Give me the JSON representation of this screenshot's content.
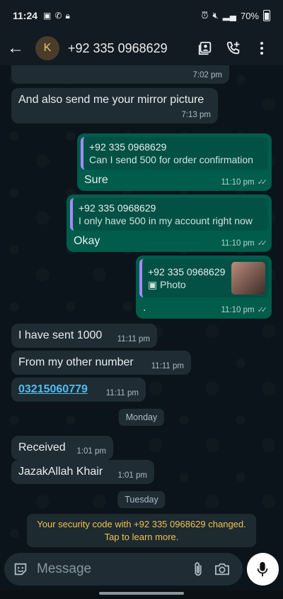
{
  "status": {
    "time": "11:24",
    "battery": "70%"
  },
  "header": {
    "avatar_letter": "K",
    "contact": "+92 335 0968629"
  },
  "messages": {
    "m0_time": "7:02 pm",
    "m1_text": "And also send me your mirror picture",
    "m1_time": "7:13 pm",
    "o1_qname": "+92 335 0968629",
    "o1_qtext": "Can I send 500 for order confirmation",
    "o1_text": "Sure",
    "o1_time": "11:10 pm",
    "o2_qname": "+92 335 0968629",
    "o2_qtext": "I only have 500 in my account right now",
    "o2_text": "Okay",
    "o2_time": "11:10 pm",
    "o3_qname": "+92 335 0968629",
    "o3_qtext": "Photo",
    "o3_text": ".",
    "o3_time": "11:10 pm",
    "i1_text": "I have sent 1000",
    "i1_time": "11:11 pm",
    "i2_text": "From my other number",
    "i2_time": "11:11 pm",
    "i3_text": "03215060779",
    "i3_time": "11:11 pm",
    "day1": "Monday",
    "i4_text": "Received",
    "i4_time": "1:01 pm",
    "i5_text": "JazakAllah Khair",
    "i5_time": "1:01 pm",
    "day2": "Tuesday",
    "security": "Your security code with +92 335 0968629 changed. Tap to learn more."
  },
  "composer": {
    "placeholder": "Message"
  },
  "colors": {
    "outgoing": "#005c4b",
    "incoming": "#1f2c34",
    "accent": "#a38bff",
    "link": "#53bdeb",
    "warning": "#f0c254"
  }
}
